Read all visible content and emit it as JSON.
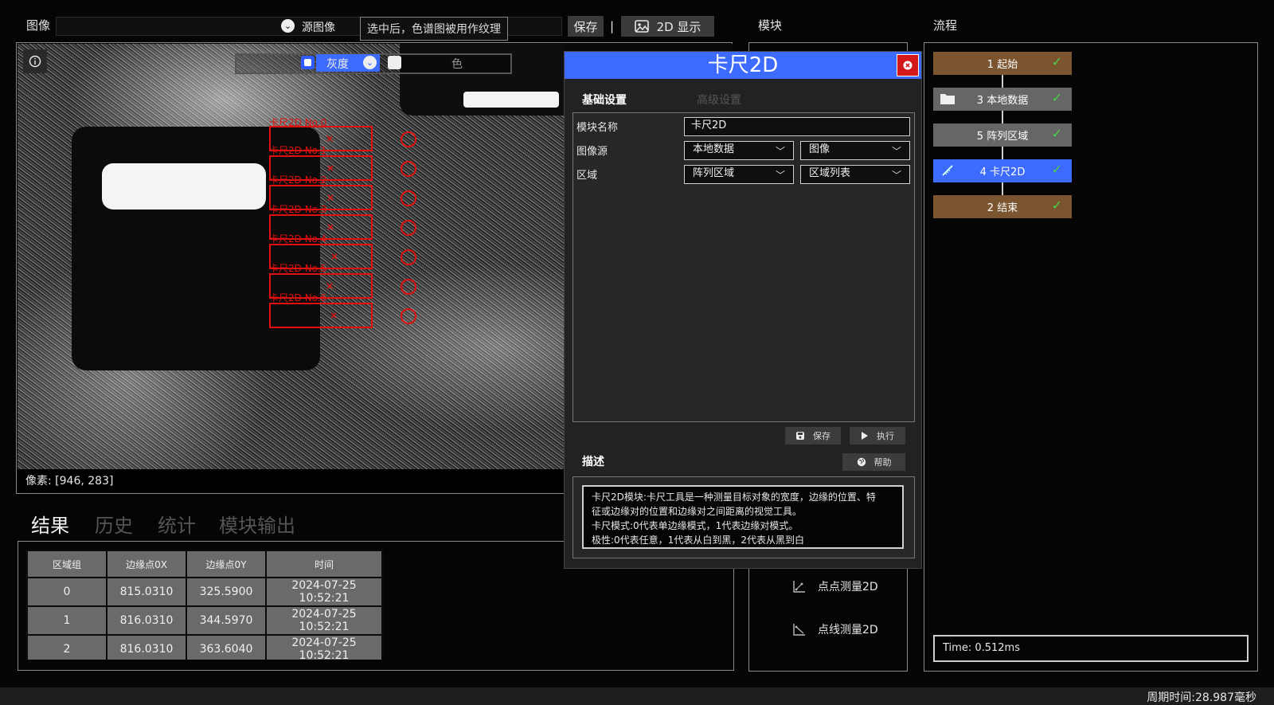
{
  "toolbar": {
    "image_label": "图像",
    "source_image": "源图像",
    "tooltip": "选中后，色谱图被用作纹理",
    "save": "保存",
    "separator": "|",
    "display_2d": "2D 显示"
  },
  "headers": {
    "module": "模块",
    "flow": "流程"
  },
  "viewer": {
    "gray_label": "灰度",
    "color_label": "色",
    "pixel_readout": "像素: [946, 283]",
    "roi_labels": [
      "卡尺2D No.0",
      "卡尺2D No.1",
      "卡尺2D No.2",
      "卡尺2D No.3",
      "卡尺2D No.4",
      "卡尺2D No.5",
      "卡尺2D No.6"
    ]
  },
  "results": {
    "tabs": [
      "结果",
      "历史",
      "统计",
      "模块输出"
    ],
    "columns": [
      "区域组",
      "边缘点0X",
      "边缘点0Y",
      "时间"
    ],
    "rows": [
      [
        "0",
        "815.0310",
        "325.5900",
        "2024-07-25 10:52:21"
      ],
      [
        "1",
        "816.0310",
        "344.5970",
        "2024-07-25 10:52:21"
      ],
      [
        "2",
        "816.0310",
        "363.6040",
        "2024-07-25 10:52:21"
      ]
    ]
  },
  "dialog": {
    "title": "卡尺2D",
    "tabs": {
      "basic": "基础设置",
      "advanced": "高级设置"
    },
    "fields": {
      "module_name_label": "模块名称",
      "module_name_value": "卡尺2D",
      "image_source_label": "图像源",
      "image_source_1": "本地数据",
      "image_source_2": "图像",
      "region_label": "区域",
      "region_1": "阵列区域",
      "region_2": "区域列表"
    },
    "buttons": {
      "save": "保存",
      "execute": "执行",
      "help": "帮助"
    },
    "description_label": "描述",
    "description_lines": [
      "卡尺2D模块:卡尺工具是一种测量目标对象的宽度，边缘的位置、特",
      "征或边缘对的位置和边缘对之间距离的视觉工具。",
      "卡尺模式:0代表单边缘模式，1代表边缘对模式。",
      "极性:0代表任意，1代表从白到黑，2代表从黑到白"
    ]
  },
  "module_list": [
    {
      "icon": "point-point-measure-icon",
      "label": "点点测量2D"
    },
    {
      "icon": "point-line-measure-icon",
      "label": "点线测量2D"
    }
  ],
  "flow": {
    "nodes": [
      {
        "label": "1 起始",
        "color": "#7a5530"
      },
      {
        "label": "3 本地数据",
        "color": "#666666"
      },
      {
        "label": "5 阵列区域",
        "color": "#666666"
      },
      {
        "label": "4 卡尺2D",
        "color": "#3d6bff"
      },
      {
        "label": "2 结束",
        "color": "#7a5530"
      }
    ],
    "time": "Time: 0.512ms"
  },
  "status": {
    "cycle_time": "周期时间:28.987毫秒"
  }
}
